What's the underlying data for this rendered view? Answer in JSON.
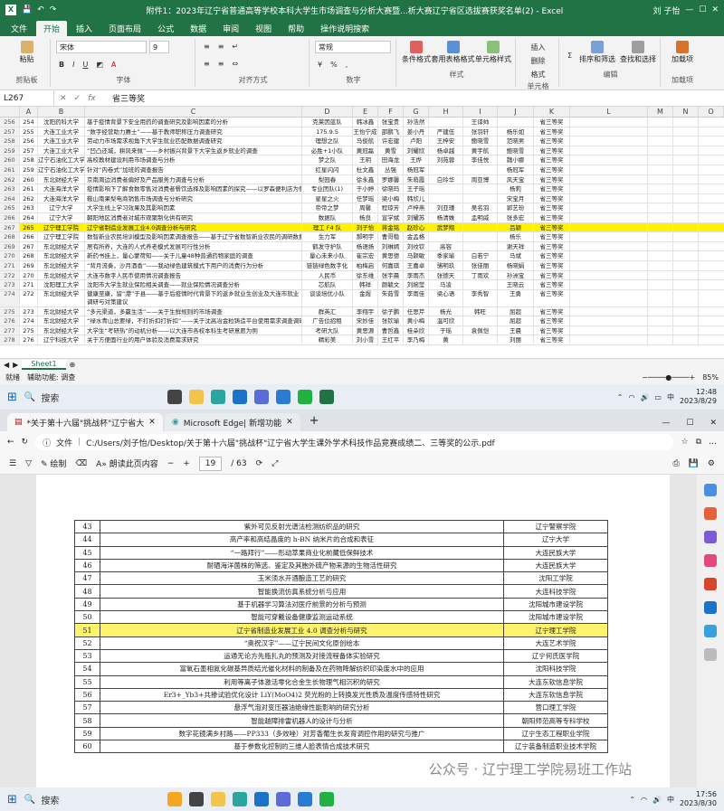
{
  "excel": {
    "title": "附件1：2023年辽宁省普通高等学校本科大学生市场调查与分析大赛暨...析大赛辽宁省区选拔赛获奖名单(2) - Excel",
    "user": "刘 子怡",
    "tabs": [
      "文件",
      "开始",
      "插入",
      "页面布局",
      "公式",
      "数据",
      "审阅",
      "视图",
      "帮助",
      "操作说明搜索"
    ],
    "ribbon": {
      "paste": "粘贴",
      "clipboard": "剪贴板",
      "font_name": "宋体",
      "font_size": "9",
      "font": "字体",
      "align": "对齐方式",
      "num_format": "常规",
      "number": "数字",
      "cond": "条件格式",
      "table": "套用表格格式",
      "cellstyle": "单元格样式",
      "styles": "样式",
      "insert": "插入",
      "delete": "删除",
      "format": "格式",
      "cells": "单元格",
      "sort": "排序和筛选",
      "find": "查找和选择",
      "editing": "编辑",
      "addin": "加载项",
      "addins": "加载项"
    },
    "namebox": "L267",
    "formula": "省三等奖",
    "cols": [
      "A",
      "B",
      "C",
      "D",
      "E",
      "F",
      "G",
      "H",
      "I",
      "J",
      "K",
      "L",
      "M",
      "N",
      "O"
    ],
    "rows": [
      [
        "256",
        "254",
        "沈阳药科大学",
        "基于疫情背景下安全用药的调查研究及影响因素的分析",
        "克莱因蓝队",
        "韩冰鑫",
        "张宝贵",
        "孙浩然",
        "",
        "王译帅",
        "",
        "省三等奖"
      ],
      [
        "257",
        "255",
        "大连工业大学",
        "“数字经营助力赓士”——基于教师职称压力调查研究",
        "175.9.5",
        "王怡宁成",
        "邵鹏飞",
        "姜小丹",
        "严建伍",
        "张羽轩",
        "杨乐如",
        "省三等奖"
      ],
      [
        "258",
        "256",
        "大连工业大学",
        "劳动力市场需求视角下大学生就业匹配数据调查研究",
        "理想之队",
        "马俊航",
        "许宏建",
        "卢阳",
        "王梓安",
        "鲍晓雪",
        "范晓男",
        "省三等奖"
      ],
      [
        "259",
        "257",
        "大连工业大学",
        "“凹凸还城，耕风来佩”——乡村振兴背景下大学生返乡就业的调查",
        "必胜+1小队",
        "黄冠磊",
        "黄雪",
        "刘耀欣",
        "杨卓越",
        "黄宇航",
        "鲍晓雪",
        "省三等奖"
      ],
      [
        "260",
        "258",
        "辽宁石油化工大学",
        "高校教材建设利用市场调查与分析",
        "梦之队",
        "王玥",
        "田海龙",
        "王烨",
        "刘苑蓉",
        "李佳悦",
        "魏小娜",
        "省三等奖"
      ],
      [
        "261",
        "259",
        "辽宁石油化工大学",
        "针对“内卷式”加班的调查报告",
        "红星闪闪",
        "杜文鑫",
        "丛强",
        "杨冠军",
        "",
        "",
        "杨冠军",
        "省三等奖"
      ],
      [
        "262",
        "260",
        "东北财经大学",
        "京南周边消费者偏好及产品服务力调查与分析",
        "梨园春",
        "徐永鑫",
        "罗娜馨",
        "朱萌霞",
        "白玲华",
        "周亚博",
        "风天宝",
        "省三等奖"
      ],
      [
        "263",
        "261",
        "大连海洋大学",
        "疫情影响下了解食数零售对消费者餐饮选择及影响因素的探究——以罗森便利店为例",
        "专业团队(1)",
        "于小婷",
        "徐晓玛",
        "王子瑶",
        "",
        "",
        "杨莉",
        "省三等奖"
      ],
      [
        "264",
        "262",
        "大连海洋大学",
        "鞍山南果梨电商销售市场调查与分析研究",
        "星星之火",
        "任梦瑶",
        "梁小梅",
        "韩欣儿",
        "",
        "",
        "宋宝月",
        "省三等奖"
      ],
      [
        "265",
        "263",
        "辽宁大学",
        "大学生线上学习效果及其影响因素",
        "帝帝之梦",
        "周馨",
        "程琼芳",
        "卢梓燕",
        "刘亚瑾",
        "吴名羽",
        "郭艺玢",
        "省三等奖"
      ],
      [
        "266",
        "264",
        "辽宁大学",
        "朝阳地区消费者对城市观聚制化供有研究",
        "数据队",
        "杨良",
        "宣学斌",
        "刘耀苏",
        "杨清姝",
        "孟明威",
        "张多宏",
        "省三等奖"
      ],
      [
        "267",
        "265",
        "辽宁理工学院",
        "辽宁省制造业发展工业4.0调查分析与研究",
        "理工 F4 队",
        "刘子怡",
        "蒋金铭",
        "赵珍心",
        "武梦翔",
        "",
        "吕颖",
        "省三等奖"
      ],
      [
        "268",
        "266",
        "辽宁理工学院",
        "数智新业农民培训模型及影响因素调查报告——基于辽宁省数智新业农民的调研数据",
        "生力军",
        "郝明宇",
        "曹哥稳",
        "金孟格",
        "",
        "",
        "杨乐",
        "省三等奖"
      ],
      [
        "269",
        "267",
        "东北财经大学",
        "居有所养，大连的人式养老模式发展可行性分析",
        "鹤发守护队",
        "杨语扬",
        "刘琳嫣",
        "刘纹钦",
        "高容",
        "",
        "谢天祥",
        "省三等奖"
      ],
      [
        "270",
        "268",
        "东北财经大学",
        "新药书挂上，量心蒙荷知——关于儿童48种普通药物家庭的调查",
        "量心未来小队",
        "崔宗宏",
        "黄思德",
        "马颢敏",
        "季家瑜",
        "白若宁",
        "马斌",
        "省三等奖"
      ],
      [
        "271",
        "269",
        "东北财经大学",
        "“背月流奏，沙月酒香”——我动绿色建筑模式下用户的消费行为分析",
        "链链绿色数字化",
        "柏梅启",
        "何嘉琪",
        "王嘉卓",
        "骆明玖",
        "张佳丽",
        "杨晓娟",
        "省三等奖"
      ],
      [
        "272",
        "270",
        "东北财经大学",
        "大连市数字人民币使用情况调查报告",
        "人民币",
        "徐东维",
        "张宇晨",
        "李雨杰",
        "张德天",
        "丁雨欢",
        "孙洲宝",
        "省三等奖"
      ],
      [
        "273",
        "271",
        "沈阳理工大学",
        "沈阳市大学生就业保险相关调查——就业保险情况调查分析",
        "芯航队",
        "韩祥",
        "颜毓文",
        "刘婉莹",
        "马凌",
        "",
        "王晓云",
        "省三等奖"
      ],
      [
        "274",
        "272",
        "东北财经大学",
        "健康至康，留“港”于县——基于后疫情时代背景下的返乡就业生创业及大连市就业调研与对策建议",
        "谈谈培优小队",
        "金煜",
        "朱茹雪",
        "李雨佳",
        "梁心语",
        "李秀智",
        "王勇",
        "省三等奖"
      ],
      [
        "275",
        "273",
        "东北财经大学",
        "“多元渠道，多赢生活”——关于生鲜规则的市场调查",
        "群英汇",
        "李翔宇",
        "徐子鹏",
        "任思芹",
        "杨光",
        "韩旺",
        "屈超",
        "省三等奖"
      ],
      [
        "276",
        "274",
        "东北财经大学",
        "“绿水青山总要绿，不打折扣打折扣”——关于沈高冶金粒铸造平台使用需求调查调研",
        "广告位招租",
        "宋妙佳",
        "张钦瑜",
        "黄小梅",
        "温可欣",
        "",
        "屈超",
        "省三等奖"
      ],
      [
        "277",
        "275",
        "东北财经大学",
        "大学生“考研热”的动机分析——以大连市各校本科生考研意愿为例",
        "考研大队",
        "黄思源",
        "曹哲鑫",
        "桂朵欣",
        "于瑶",
        "袁佩恺",
        "王晨",
        "省三等奖"
      ],
      [
        "278",
        "276",
        "辽宁科技大学",
        "关于方便面行业的用户体验及消费需求研究",
        "精彩美",
        "刘小雪",
        "王红平",
        "李乃梅",
        "黄",
        "",
        "刘丽",
        "省三等奖"
      ]
    ],
    "sheet_tab": "Sheet1",
    "status_left": "就绪",
    "status_acc": "辅助功能: 调查",
    "zoom": "85%"
  },
  "taskbar1": {
    "search": "搜索",
    "time": "12:48",
    "date": "2023/8/29",
    "lang": "中"
  },
  "edge": {
    "tab1": "*关于第十六届\"挑战杯\"辽宁省大",
    "tab2": "Microsoft Edge| 新增功能",
    "file_label": "文件",
    "url": "C:/Users/刘子怡/Desktop/关于第十六届\"挑战杯\"辽宁省大学生课外学术科技作品竞赛成绩二、三等奖的公示.pdf",
    "draw": "绘制",
    "read": "朗读此页内容",
    "page": "19",
    "total": "/ 63",
    "rows": [
      [
        "43",
        "紫外可见反射光谱法检测纺织品的研究",
        "辽宁警察学院"
      ],
      [
        "44",
        "高产率和高结晶度的 h-BN 纳米片的合成和表征",
        "辽宁大学"
      ],
      [
        "45",
        "“一路拜行”——形动萃果商业化前藏低保鲜技术",
        "大连民族大学"
      ],
      [
        "46",
        "耐硒海洋菌株的筛选、鉴定及其胞外硫产物来源的生物活性研究",
        "大连民族大学"
      ],
      [
        "47",
        "玉米须水开酒酿造工艺的研究",
        "沈阳工学院"
      ],
      [
        "48",
        "智能换流仿真系统分析与应用",
        "大连科技学院"
      ],
      [
        "49",
        "基于机器学习算法对医疗前景的分析与预测",
        "沈阳城市建设学院"
      ],
      [
        "50",
        "智能可穿戴设备健康监测运动系统",
        "沈阳城市建设学院"
      ],
      [
        "51",
        "辽宁省制造业发展工业 4.0 调查分析与研究",
        "辽宁理工学院"
      ],
      [
        "52",
        "“奥祝汉字”——辽宁民间文化原创绘本",
        "大连艺术学院"
      ],
      [
        "53",
        "运通无论方先瓶扎丸的预测及对接流程备体实验研究",
        "辽宁何氏医学院"
      ],
      [
        "54",
        "富氧石墨相氮化碳基异质结光催化材料的制备及在药物降解纺织印染废水中的应用",
        "沈阳科技学院"
      ],
      [
        "55",
        "利用等离子体激活零化合金生长物理气相沉积的研究",
        "大连东软信息学院"
      ],
      [
        "56",
        "Er3+_Yb3+共掺试验优化设计 LiY(MoO4)2 荧光粉的上转换发光性质及温度传感特性研究",
        "大连东软信息学院"
      ],
      [
        "57",
        "悬浮气泡对变压器油绝缘性能影响的研究分析",
        "营口理工学院"
      ],
      [
        "58",
        "智能越障排雷机器人的设计与分析",
        "朝阳师范高等专科学校"
      ],
      [
        "59",
        "数字花镜满乡村路——PP333（多效唑）对芳香葡生长发育调控作用的研究与推广",
        "辽宁生态工程职业学院"
      ],
      [
        "60",
        "基于参数化控制的三维人脸表情合成技术研究",
        "辽宁装备制造职业技术学院"
      ]
    ],
    "highlight_row": "51",
    "watermark": "公众号 · 辽宁理工学院易班工作站"
  },
  "taskbar2": {
    "search": "搜索",
    "time": "17:56",
    "date": "2023/8/30",
    "lang": "中"
  }
}
